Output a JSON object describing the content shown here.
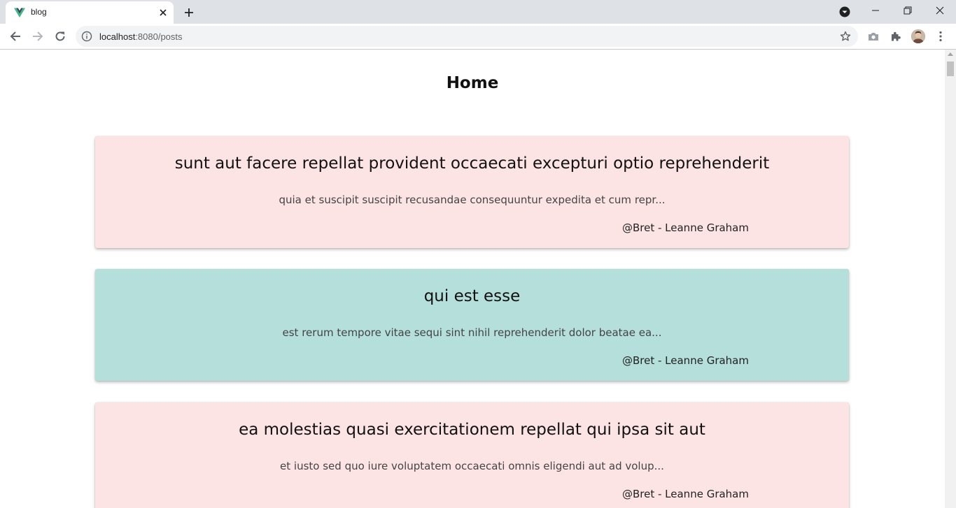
{
  "browser": {
    "tab_title": "blog",
    "url_host": "localhost",
    "url_port_path": ":8080/posts"
  },
  "page": {
    "heading": "Home"
  },
  "posts": [
    {
      "title": "sunt aut facere repellat provident occaecati excepturi optio reprehenderit",
      "excerpt": "quia et suscipit suscipit recusandae consequuntur expedita et cum repr...",
      "author": "@Bret - Leanne Graham",
      "color": "#fde4e4"
    },
    {
      "title": "qui est esse",
      "excerpt": "est rerum tempore vitae sequi sint nihil reprehenderit dolor beatae ea...",
      "author": "@Bret - Leanne Graham",
      "color": "#b4dfdb"
    },
    {
      "title": "ea molestias quasi exercitationem repellat qui ipsa sit aut",
      "excerpt": "et iusto sed quo iure voluptatem occaecati omnis eligendi aut ad volup...",
      "author": "@Bret - Leanne Graham",
      "color": "#fde4e4"
    }
  ],
  "colors": {
    "card_pink": "#fde4e4",
    "card_teal": "#b4dfdb",
    "vue_green": "#41b883",
    "vue_dark": "#35495e"
  },
  "icons": {
    "favicon": "vue-logo-icon",
    "back": "arrow-left-icon",
    "forward": "arrow-right-icon",
    "reload": "reload-icon",
    "info": "info-icon",
    "star": "star-icon",
    "camera": "camera-icon",
    "extensions": "puzzle-icon",
    "menu": "kebab-menu-icon"
  }
}
